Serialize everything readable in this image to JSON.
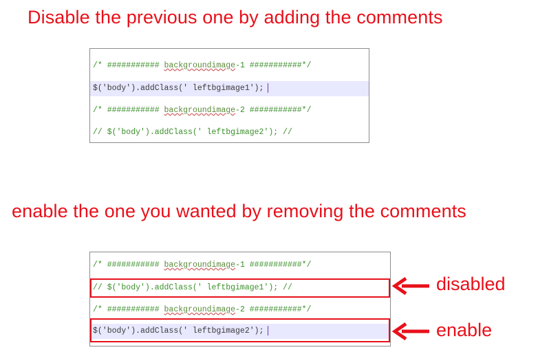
{
  "headings": {
    "top": "Disable the previous one by adding the comments",
    "bottom": "enable the one you wanted by removing the comments"
  },
  "panel1": {
    "lines": [
      {
        "pre": "/* ########### ",
        "link": "backgroundimage",
        "post": "-1 ###########*/",
        "kind": "comment"
      },
      {
        "code": " $('body').addClass(' leftbgimage1');",
        "kind": "code",
        "highlight": true
      },
      {
        "pre": "/* ########### ",
        "link": "backgroundimage",
        "post": "-2 ###########*/",
        "kind": "comment"
      },
      {
        "code": "// $('body').addClass(' leftbgimage2'); //",
        "kind": "commented-code"
      }
    ]
  },
  "panel2": {
    "lines": [
      {
        "pre": "/* ########### ",
        "link": "backgroundimage",
        "post": "-1 ###########*/",
        "kind": "comment"
      },
      {
        "code": "// $('body').addClass(' leftbgimage1'); //",
        "kind": "commented-code"
      },
      {
        "pre": "/* ########### ",
        "link": "backgroundimage",
        "post": "-2 ###########*/",
        "kind": "comment"
      },
      {
        "code": " $('body').addClass(' leftbgimage2');",
        "kind": "code",
        "highlight": true
      }
    ]
  },
  "annotations": {
    "disabled": "disabled",
    "enable": "enable"
  },
  "colors": {
    "accent": "#e8101a",
    "comment": "#3a8f2a",
    "highlight": "#e8e8ff"
  }
}
